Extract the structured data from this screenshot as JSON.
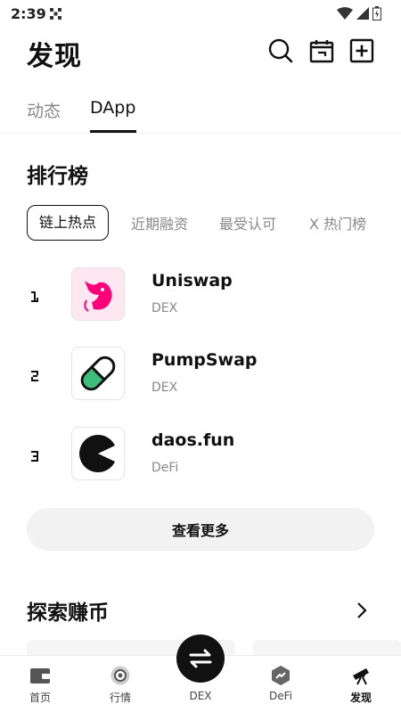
{
  "status_bar": {
    "time": "2:39"
  },
  "header": {
    "title": "发现",
    "icons": [
      "search-icon",
      "calendar-icon",
      "add-icon"
    ]
  },
  "tabs": [
    {
      "label": "动态",
      "active": false
    },
    {
      "label": "DApp",
      "active": true
    }
  ],
  "ranking": {
    "title": "排行榜",
    "chips": [
      {
        "label": "链上热点",
        "active": true
      },
      {
        "label": "近期融资",
        "active": false
      },
      {
        "label": "最受认可",
        "active": false
      },
      {
        "label": "X 热门榜",
        "active": false
      }
    ],
    "items": [
      {
        "rank": "1",
        "name": "Uniswap",
        "tag": "DEX",
        "logo": "uniswap-unicorn-icon"
      },
      {
        "rank": "2",
        "name": "PumpSwap",
        "tag": "DEX",
        "logo": "pill-capsule-icon"
      },
      {
        "rank": "3",
        "name": "daos.fun",
        "tag": "DeFi",
        "logo": "pacman-icon"
      }
    ],
    "more_label": "查看更多"
  },
  "explore": {
    "title": "探索赚币"
  },
  "bottom_nav": [
    {
      "label": "首页",
      "icon": "wallet-icon",
      "active": false
    },
    {
      "label": "行情",
      "icon": "market-icon",
      "active": false
    },
    {
      "label": "DEX",
      "icon": "swap-icon",
      "active": false
    },
    {
      "label": "DeFi",
      "icon": "defi-icon",
      "active": false
    },
    {
      "label": "发现",
      "icon": "telescope-icon",
      "active": true
    }
  ],
  "colors": {
    "text": "#111111",
    "muted": "#888888",
    "accent": "#111111",
    "uniswap_pink": "#FF007A",
    "pumpswap_green": "#3DBE7A"
  }
}
